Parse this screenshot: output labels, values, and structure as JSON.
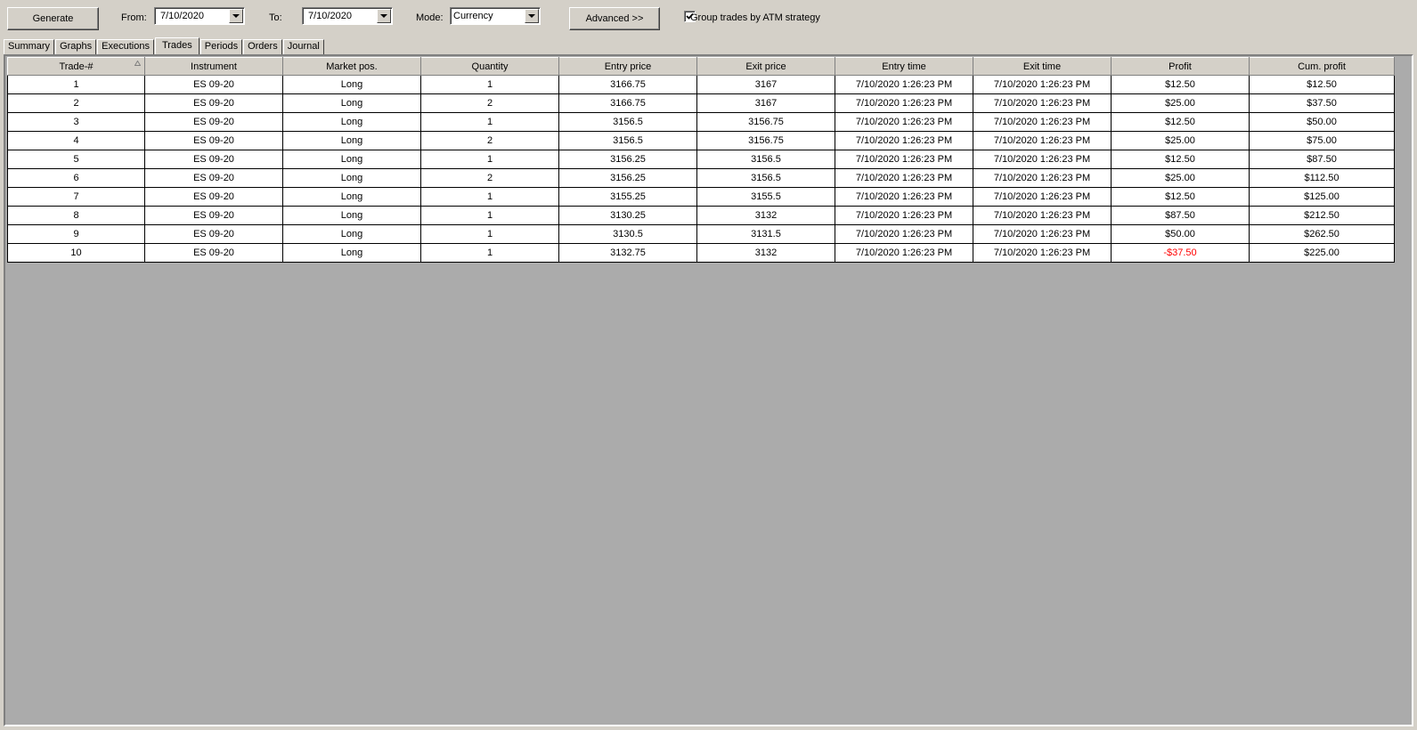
{
  "toolbar": {
    "generate_label": "Generate",
    "from_label": "From:",
    "from_value": "7/10/2020",
    "to_label": "To:",
    "to_value": "7/10/2020",
    "mode_label": "Mode:",
    "mode_value": "Currency",
    "advanced_label": "Advanced >>",
    "group_label": "Group trades by ATM strategy",
    "group_checked": true
  },
  "tabs": [
    {
      "label": "Summary"
    },
    {
      "label": "Graphs"
    },
    {
      "label": "Executions"
    },
    {
      "label": "Trades",
      "active": true
    },
    {
      "label": "Periods"
    },
    {
      "label": "Orders"
    },
    {
      "label": "Journal"
    }
  ],
  "grid": {
    "columns": [
      "Trade-#",
      "Instrument",
      "Market pos.",
      "Quantity",
      "Entry price",
      "Exit price",
      "Entry time",
      "Exit time",
      "Profit",
      "Cum. profit"
    ],
    "sorted_column": "Trade-#",
    "rows": [
      [
        "1",
        "ES 09-20",
        "Long",
        "1",
        "3166.75",
        "3167",
        "7/10/2020 1:26:23 PM",
        "7/10/2020 1:26:23 PM",
        "$12.50",
        "$12.50"
      ],
      [
        "2",
        "ES 09-20",
        "Long",
        "2",
        "3166.75",
        "3167",
        "7/10/2020 1:26:23 PM",
        "7/10/2020 1:26:23 PM",
        "$25.00",
        "$37.50"
      ],
      [
        "3",
        "ES 09-20",
        "Long",
        "1",
        "3156.5",
        "3156.75",
        "7/10/2020 1:26:23 PM",
        "7/10/2020 1:26:23 PM",
        "$12.50",
        "$50.00"
      ],
      [
        "4",
        "ES 09-20",
        "Long",
        "2",
        "3156.5",
        "3156.75",
        "7/10/2020 1:26:23 PM",
        "7/10/2020 1:26:23 PM",
        "$25.00",
        "$75.00"
      ],
      [
        "5",
        "ES 09-20",
        "Long",
        "1",
        "3156.25",
        "3156.5",
        "7/10/2020 1:26:23 PM",
        "7/10/2020 1:26:23 PM",
        "$12.50",
        "$87.50"
      ],
      [
        "6",
        "ES 09-20",
        "Long",
        "2",
        "3156.25",
        "3156.5",
        "7/10/2020 1:26:23 PM",
        "7/10/2020 1:26:23 PM",
        "$25.00",
        "$112.50"
      ],
      [
        "7",
        "ES 09-20",
        "Long",
        "1",
        "3155.25",
        "3155.5",
        "7/10/2020 1:26:23 PM",
        "7/10/2020 1:26:23 PM",
        "$12.50",
        "$125.00"
      ],
      [
        "8",
        "ES 09-20",
        "Long",
        "1",
        "3130.25",
        "3132",
        "7/10/2020 1:26:23 PM",
        "7/10/2020 1:26:23 PM",
        "$87.50",
        "$212.50"
      ],
      [
        "9",
        "ES 09-20",
        "Long",
        "1",
        "3130.5",
        "3131.5",
        "7/10/2020 1:26:23 PM",
        "7/10/2020 1:26:23 PM",
        "$50.00",
        "$262.50"
      ],
      [
        "10",
        "ES 09-20",
        "Long",
        "1",
        "3132.75",
        "3132",
        "7/10/2020 1:26:23 PM",
        "7/10/2020 1:26:23 PM",
        "-$37.50",
        "$225.00"
      ]
    ]
  },
  "colors": {
    "window_bg": "#d4d0c8",
    "panel_bg": "#ababab",
    "negative": "#ff0000"
  },
  "icons": {
    "dropdown": "chevron-down-icon",
    "checkbox": "checkmark-icon",
    "sort": "sort-ascending-icon"
  }
}
